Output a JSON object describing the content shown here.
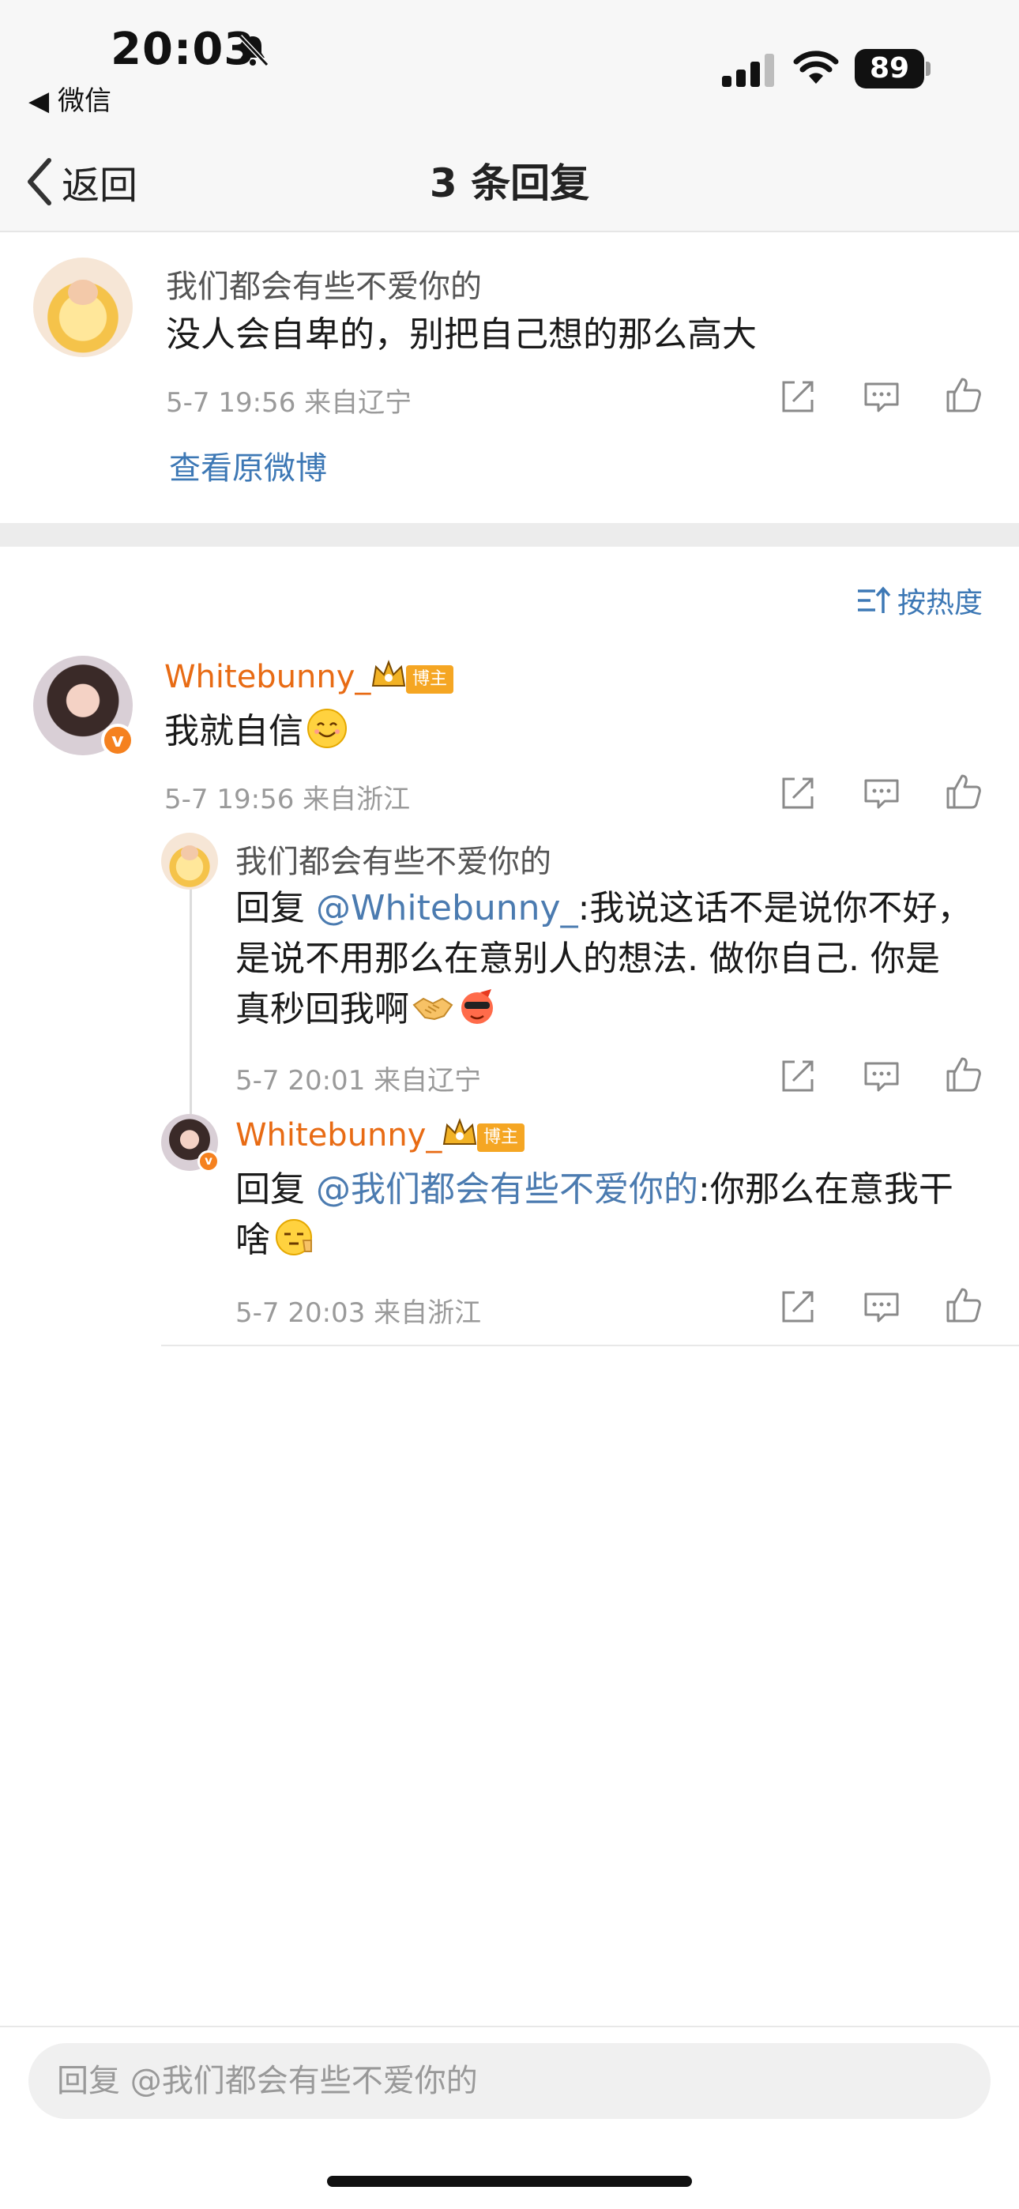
{
  "status_bar": {
    "time": "20:03",
    "back_app": "◀ 微信",
    "battery": "89"
  },
  "nav": {
    "back_label": "返回",
    "title": "3 条回复"
  },
  "original_post": {
    "username": "我们都会有些不爱你的",
    "text": "没人会自卑的，别把自己想的那么高大",
    "meta": "5-7 19:56  来自辽宁",
    "view_link": "查看原微博"
  },
  "sort_label": "按热度",
  "comment": {
    "username": "Whitebunny_",
    "badge": "博主",
    "text": "我就自信",
    "meta": "5-7 19:56  来自浙江"
  },
  "replies": [
    {
      "username": "我们都会有些不爱你的",
      "prefix": "回复 ",
      "mention": "@Whitebunny_",
      "line1": ":我说这话不是说你不好，",
      "line2": "是说不用那么在意别人的想法. 做你自己. 你是",
      "line3": "真秒回我啊",
      "meta": "5-7 20:01  来自辽宁"
    },
    {
      "username": "Whitebunny_",
      "badge": "博主",
      "prefix": "回复 ",
      "mention": "@我们都会有些不爱你的",
      "line1": ":你那么在意我干",
      "line2": "啥",
      "meta": "5-7 20:03  来自浙江"
    }
  ],
  "reply_placeholder": "回复 @我们都会有些不爱你的",
  "colors": {
    "accent_orange": "#e86b14",
    "link_blue": "#3d78b5",
    "mention_blue": "#4b7bb0",
    "verified": "#f5811f"
  },
  "icons": [
    "bell-mute-icon",
    "signal-icon",
    "wifi-icon",
    "battery-icon",
    "back-chevron-icon",
    "share-icon",
    "comment-icon",
    "like-icon",
    "sort-icon",
    "crown-icon"
  ]
}
